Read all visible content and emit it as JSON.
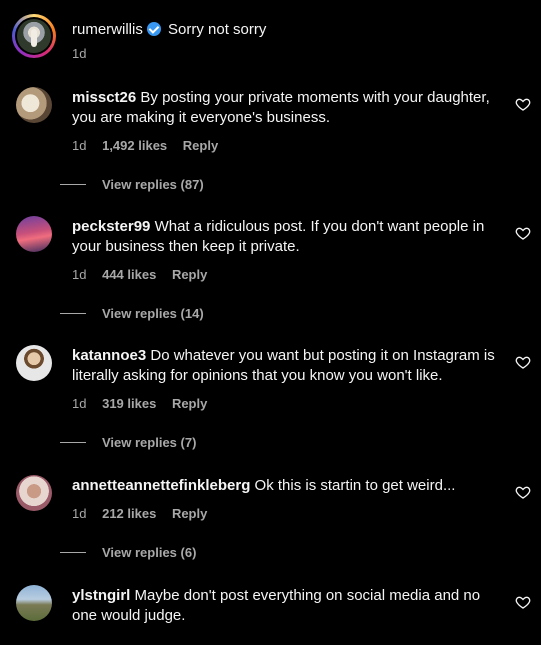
{
  "caption": {
    "username": "rumerwillis",
    "text": "Sorry not sorry",
    "time": "1d"
  },
  "comments": [
    {
      "username": "missct26",
      "text": "By posting your private moments with your daughter, you are making it everyone's business.",
      "time": "1d",
      "likes": "1,492 likes",
      "reply": "Reply",
      "view_replies": "View replies (87)"
    },
    {
      "username": "peckster99",
      "text": "What a ridiculous post. If you don't want people in your business then keep it private.",
      "time": "1d",
      "likes": "444 likes",
      "reply": "Reply",
      "view_replies": "View replies (14)"
    },
    {
      "username": "katannoe3",
      "text": "Do whatever you want but posting it on Instagram is literally asking for opinions that you know you won't like.",
      "time": "1d",
      "likes": "319 likes",
      "reply": "Reply",
      "view_replies": "View replies (7)"
    },
    {
      "username": "annetteannettefinkleberg",
      "text": "Ok this is startin to get weird...",
      "time": "1d",
      "likes": "212 likes",
      "reply": "Reply",
      "view_replies": "View replies (6)"
    },
    {
      "username": "ylstngirl",
      "text": "Maybe don't post everything on social media and no one would judge."
    }
  ],
  "icons": {
    "heart": "heart-outline-icon",
    "verified": "verified-badge-icon"
  },
  "colors": {
    "background": "#000000",
    "text": "#f5f5f5",
    "secondary_text": "#a8a8a8",
    "verified": "#3897f0"
  }
}
